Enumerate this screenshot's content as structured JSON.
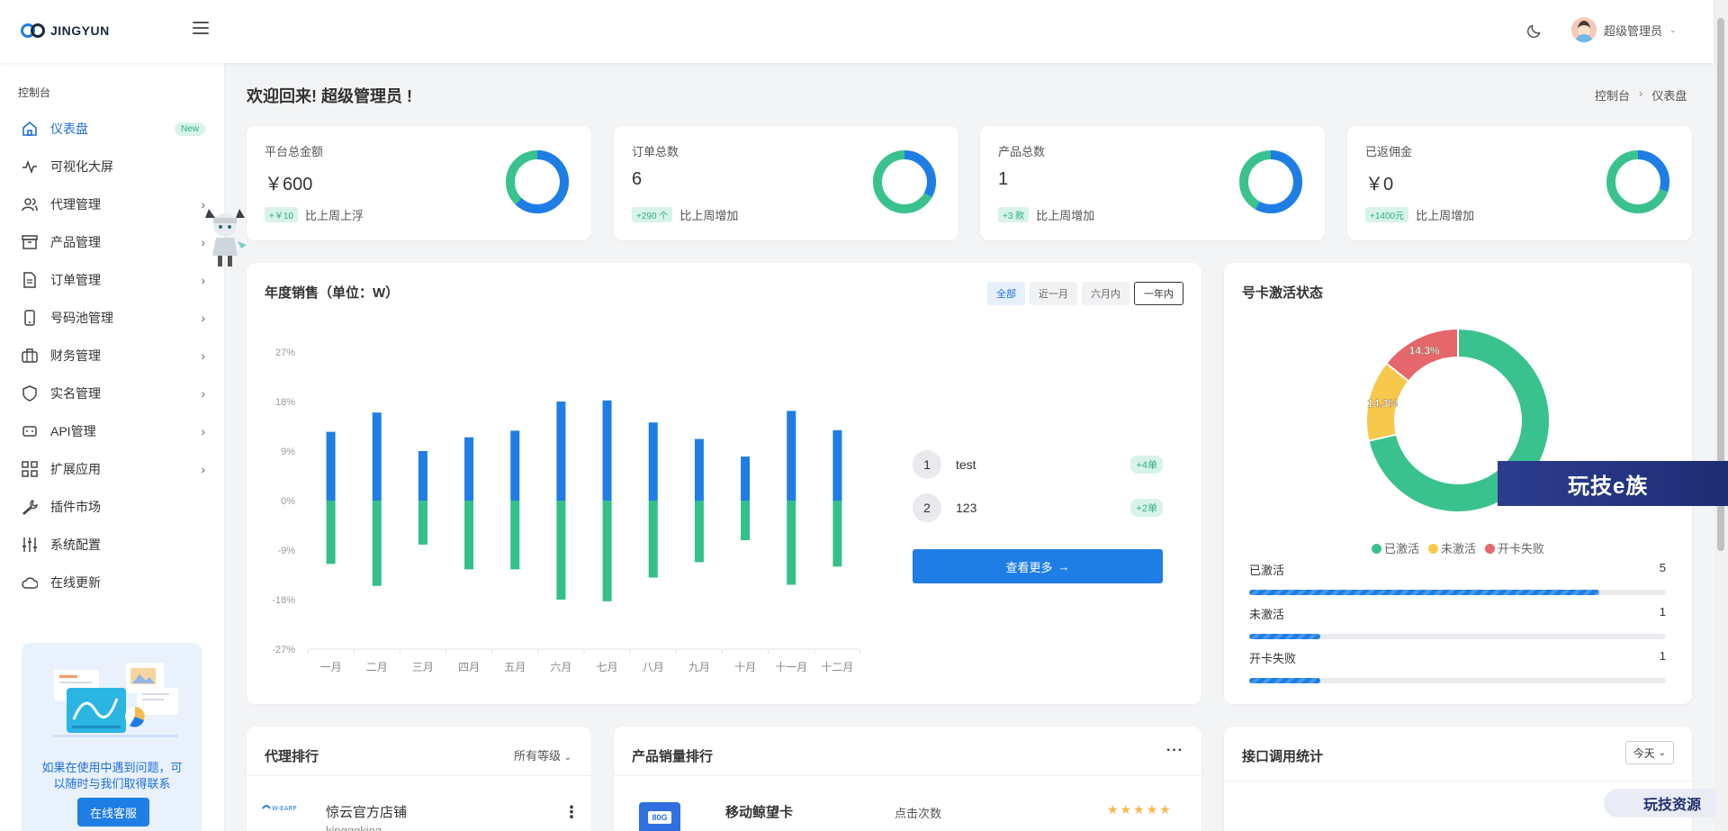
{
  "header": {
    "logo_text": "JINGYUN",
    "user_name": "超级管理员"
  },
  "sidebar": {
    "section_label": "控制台",
    "items": [
      {
        "label": "仪表盘",
        "icon": "home-icon",
        "badge": "New",
        "active": true,
        "chevron": false
      },
      {
        "label": "可视化大屏",
        "icon": "activity-icon",
        "chevron": false
      },
      {
        "label": "代理管理",
        "icon": "users-icon",
        "chevron": true
      },
      {
        "label": "产品管理",
        "icon": "archive-icon",
        "chevron": true
      },
      {
        "label": "订单管理",
        "icon": "file-icon",
        "chevron": true
      },
      {
        "label": "号码池管理",
        "icon": "phone-icon",
        "chevron": true
      },
      {
        "label": "财务管理",
        "icon": "briefcase-icon",
        "chevron": true
      },
      {
        "label": "实名管理",
        "icon": "shield-icon",
        "chevron": true
      },
      {
        "label": "API管理",
        "icon": "api-icon",
        "chevron": true
      },
      {
        "label": "扩展应用",
        "icon": "grid-icon",
        "chevron": true
      },
      {
        "label": "插件市场",
        "icon": "wrench-icon",
        "chevron": false
      },
      {
        "label": "系统配置",
        "icon": "sliders-icon",
        "chevron": false
      },
      {
        "label": "在线更新",
        "icon": "cloud-icon",
        "chevron": false
      }
    ],
    "help_text": "如果在使用中遇到问题，可以随时与我们取得联系",
    "help_button": "在线客服"
  },
  "page": {
    "welcome": "欢迎回来! 超级管理员 !",
    "breadcrumb": [
      "控制台",
      "仪表盘"
    ]
  },
  "stats": [
    {
      "title": "平台总金额",
      "value": "￥600",
      "pill": "+￥10",
      "note": "比上周上浮",
      "ring_fraction": 0.62
    },
    {
      "title": "订单总数",
      "value": "6",
      "pill": "+290 个",
      "note": "比上周增加",
      "ring_fraction": 0.33
    },
    {
      "title": "产品总数",
      "value": "1",
      "pill": "+3 款",
      "note": "比上周增加",
      "ring_fraction": 0.58
    },
    {
      "title": "已返佣金",
      "value": "￥0",
      "pill": "+1400元",
      "note": "比上周增加",
      "ring_fraction": 0.3
    }
  ],
  "sales": {
    "title": "年度销售（单位：W）",
    "ranges": [
      "全部",
      "近一月",
      "六月内",
      "一年内"
    ],
    "ranking": [
      {
        "rank": "1",
        "name": "test",
        "pill": "+4单"
      },
      {
        "rank": "2",
        "name": "123",
        "pill": "+2单"
      }
    ],
    "more_button": "查看更多",
    "colors": {
      "positive": "#1f7de6",
      "negative": "#33c089"
    }
  },
  "chart_data": {
    "type": "bar",
    "title": "年度销售（单位：W）",
    "categories": [
      "一月",
      "二月",
      "三月",
      "四月",
      "五月",
      "六月",
      "七月",
      "八月",
      "九月",
      "十月",
      "十一月",
      "十二月"
    ],
    "y_ticks": [
      "27%",
      "18%",
      "9%",
      "0%",
      "-9%",
      "-18%",
      "-27%"
    ],
    "ylim": [
      -27,
      27
    ],
    "series": [
      {
        "values": [
          12.5,
          16,
          9,
          11.5,
          12.7,
          18,
          18.2,
          14.2,
          11.2,
          8,
          16.3,
          12.8
        ]
      },
      {
        "values": [
          -11.5,
          -15.5,
          -8,
          -12.5,
          -12.5,
          -18,
          -18.3,
          -14,
          -11.2,
          -7.2,
          -15.3,
          -12
        ]
      }
    ]
  },
  "activation": {
    "title": "号卡激活状态",
    "donut": [
      {
        "label": "已激活",
        "value": 5,
        "color": "#3ac28e",
        "display": ""
      },
      {
        "label": "未激活",
        "value": 1,
        "color": "#f6c84c",
        "display": "14.3%"
      },
      {
        "label": "开卡失败",
        "value": 1,
        "color": "#e5676b",
        "display": "14.3%"
      }
    ],
    "rows": [
      {
        "label": "已激活",
        "count": "5",
        "fraction": 0.84
      },
      {
        "label": "未激活",
        "count": "1",
        "fraction": 0.17
      },
      {
        "label": "开卡失败",
        "count": "1",
        "fraction": 0.17
      }
    ]
  },
  "agent_rank": {
    "title": "代理排行",
    "filter": "所有等级",
    "first": {
      "name": "惊云官方店铺",
      "sub": "kingqqking"
    }
  },
  "product_rank": {
    "title": "产品销量排行",
    "first": {
      "name": "移动鲸望卡",
      "col": "点击次数",
      "img_text": "80G"
    }
  },
  "api_stats": {
    "title": "接口调用统计",
    "range": "今天"
  },
  "watermarks": [
    "玩技e族",
    "玩技资源"
  ]
}
